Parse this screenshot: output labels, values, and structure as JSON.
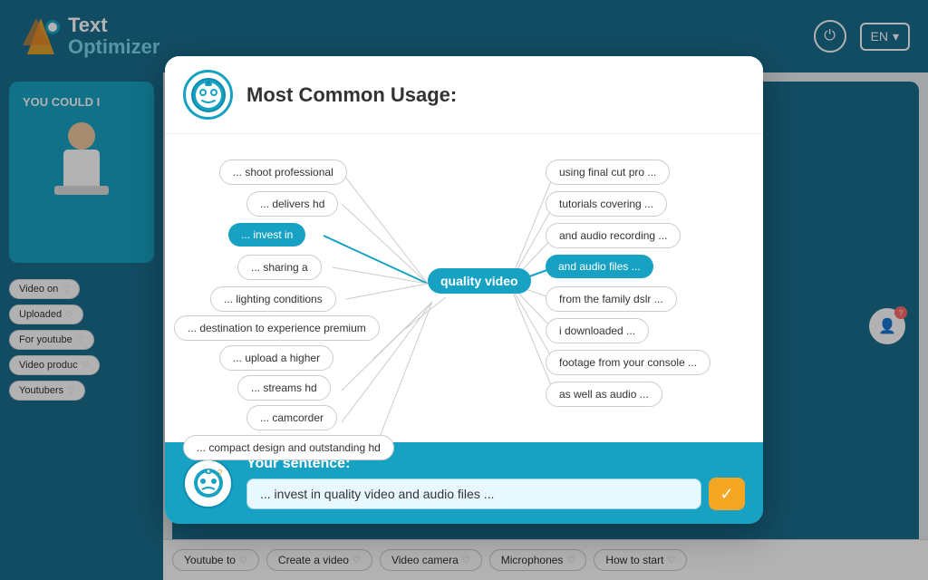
{
  "header": {
    "logo_line1": "Text",
    "logo_line2": "Optimizer",
    "lang": "EN",
    "power_icon": "⏻",
    "dropdown_icon": "▾"
  },
  "modal": {
    "title": "Most Common Usage:",
    "avatar_icon": "🤖",
    "footer_icon": "🤔",
    "sentence_label": "Your sentence:",
    "sentence_value": "... invest in quality video and audio files ...",
    "confirm_icon": "✓"
  },
  "nodes": {
    "center": "quality video",
    "left": [
      {
        "label": "... shoot professional",
        "highlighted": false
      },
      {
        "label": "... delivers hd",
        "highlighted": false
      },
      {
        "label": "... invest in",
        "highlighted": true
      },
      {
        "label": "... sharing a",
        "highlighted": false
      },
      {
        "label": "... lighting conditions",
        "highlighted": false
      },
      {
        "label": "... destination to experience premium",
        "highlighted": false
      },
      {
        "label": "... upload a higher",
        "highlighted": false
      },
      {
        "label": "... streams hd",
        "highlighted": false
      },
      {
        "label": "... camcorder",
        "highlighted": false
      },
      {
        "label": "... compact design and outstanding hd",
        "highlighted": false
      }
    ],
    "right": [
      {
        "label": "using final cut pro ...",
        "highlighted": false
      },
      {
        "label": "tutorials covering ...",
        "highlighted": false
      },
      {
        "label": "and audio recording ...",
        "highlighted": false
      },
      {
        "label": "and audio files ...",
        "highlighted": true
      },
      {
        "label": "from the family dslr ...",
        "highlighted": false
      },
      {
        "label": "i downloaded ...",
        "highlighted": false
      },
      {
        "label": "footage from your console ...",
        "highlighted": false
      },
      {
        "label": "as well as audio ...",
        "highlighted": false
      }
    ]
  },
  "sidebar": {
    "panel_title": "YOU COULD I",
    "tags": [
      {
        "label": "Video on",
        "heart": "♡"
      },
      {
        "label": "Uploaded",
        "heart": "♡"
      },
      {
        "label": "For youtube",
        "heart": "♡"
      },
      {
        "label": "Video produc",
        "heart": "♡"
      },
      {
        "label": "Youtubers",
        "heart": "♡"
      }
    ]
  },
  "bottom_tags": [
    {
      "label": "Youtube to",
      "heart": "♡"
    },
    {
      "label": "Create a video",
      "heart": "♡"
    },
    {
      "label": "Video camera",
      "heart": "♡"
    },
    {
      "label": "Microphones",
      "heart": "♡"
    },
    {
      "label": "How to start",
      "heart": "♡"
    }
  ]
}
